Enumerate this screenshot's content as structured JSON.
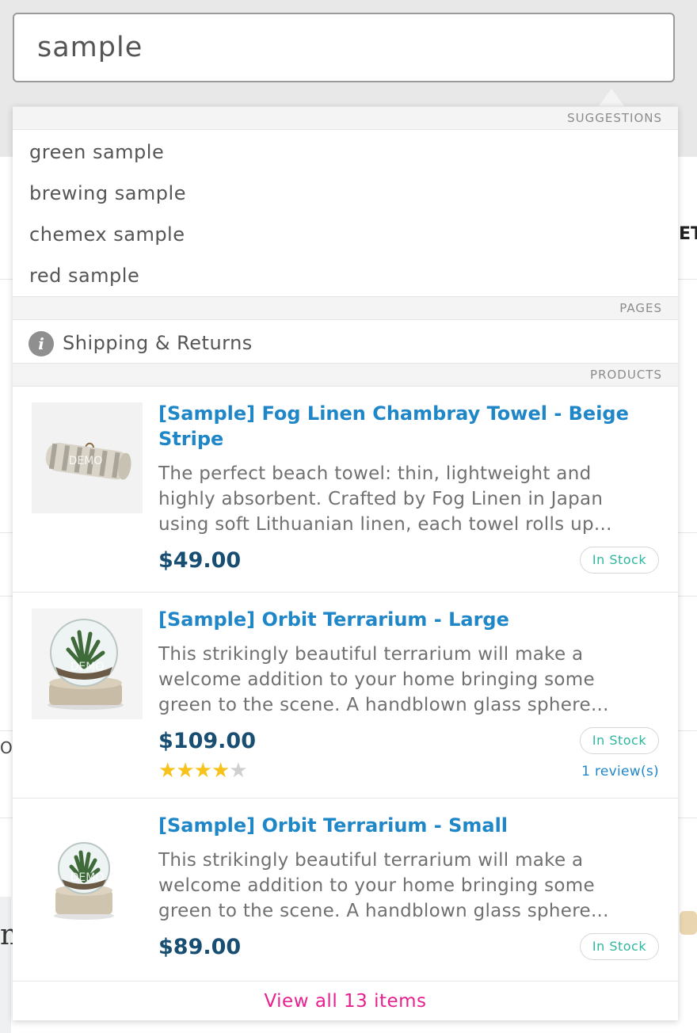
{
  "search": {
    "value": "sample"
  },
  "sections": {
    "suggestions": "SUGGESTIONS",
    "pages": "PAGES",
    "products": "PRODUCTS"
  },
  "suggestions": [
    {
      "label": "green sample"
    },
    {
      "label": "brewing sample"
    },
    {
      "label": "chemex sample"
    },
    {
      "label": "red sample"
    }
  ],
  "pages": [
    {
      "icon": "info-icon",
      "label": "Shipping & Returns"
    }
  ],
  "products": [
    {
      "title": "[Sample] Fog Linen Chambray Towel - Beige Stripe",
      "description_lines": [
        "The perfect beach towel: thin, lightweight and",
        "highly absorbent. Crafted by Fog Linen in Japan",
        "using soft Lithuanian linen, each towel rolls up..."
      ],
      "price": "$49.00",
      "stock": "In Stock",
      "image_icon": "towel-image",
      "watermark": "DEMO"
    },
    {
      "title": "[Sample] Orbit Terrarium - Large",
      "description_lines": [
        "This strikingly beautiful terrarium will make a",
        "welcome addition to your home bringing some",
        "green to the scene. A handblown glass sphere..."
      ],
      "price": "$109.00",
      "stock": "In Stock",
      "rating": 4,
      "rating_max": 5,
      "reviews": "1 review(s)",
      "image_icon": "terrarium-image",
      "watermark": "DEMO"
    },
    {
      "title": "[Sample] Orbit Terrarium - Small",
      "description_lines": [
        "This strikingly beautiful terrarium will make a",
        "welcome addition to your home bringing some",
        "green to the scene. A handblown glass sphere..."
      ],
      "price": "$89.00",
      "stock": "In Stock",
      "image_icon": "terrarium-image",
      "watermark": "DEMO"
    }
  ],
  "view_all": "View all 13 items",
  "background_fragments": {
    "right_text": "ETU",
    "left_text": "O",
    "left_bottom_text": "n"
  },
  "colors": {
    "link": "#1f86c8",
    "price": "#184e72",
    "in_stock": "#2db79f",
    "view_all": "#e8208f",
    "star": "#f7c21c"
  }
}
